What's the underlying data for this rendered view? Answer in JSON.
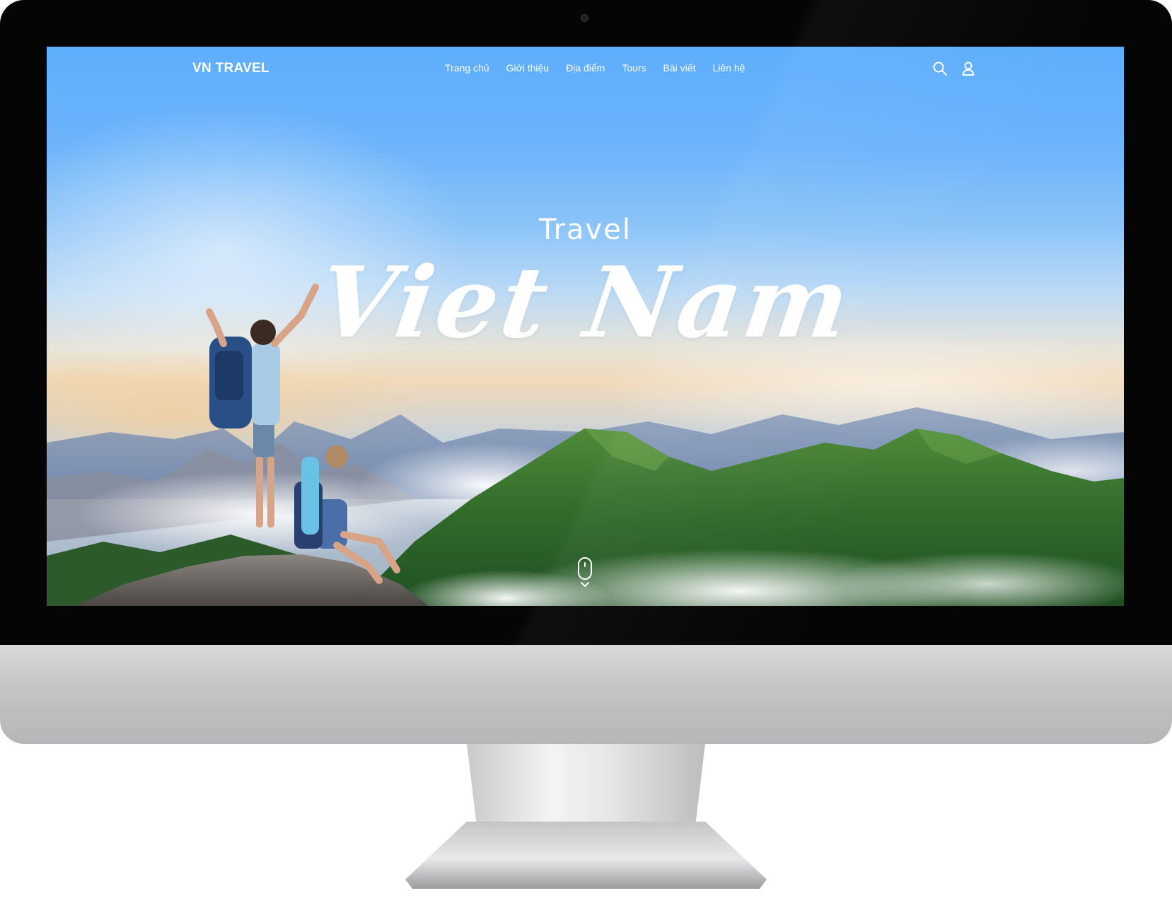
{
  "site": {
    "logo": "VN TRAVEL"
  },
  "nav": {
    "items": [
      {
        "label": "Trang chủ"
      },
      {
        "label": "Giới thiệu"
      },
      {
        "label": "Địa điểm"
      },
      {
        "label": "Tours"
      },
      {
        "label": "Bài viết"
      },
      {
        "label": "Liên hệ"
      }
    ]
  },
  "header_icons": {
    "search": "search-icon",
    "user": "user-icon"
  },
  "hero": {
    "subtitle": "Travel",
    "title": "Viet Nam"
  },
  "scroll_indicator": {
    "icon": "mouse-scroll-icon"
  },
  "colors": {
    "sky": "#5eaefc",
    "text": "#ffffff",
    "mountain": "#2f6a2a"
  }
}
